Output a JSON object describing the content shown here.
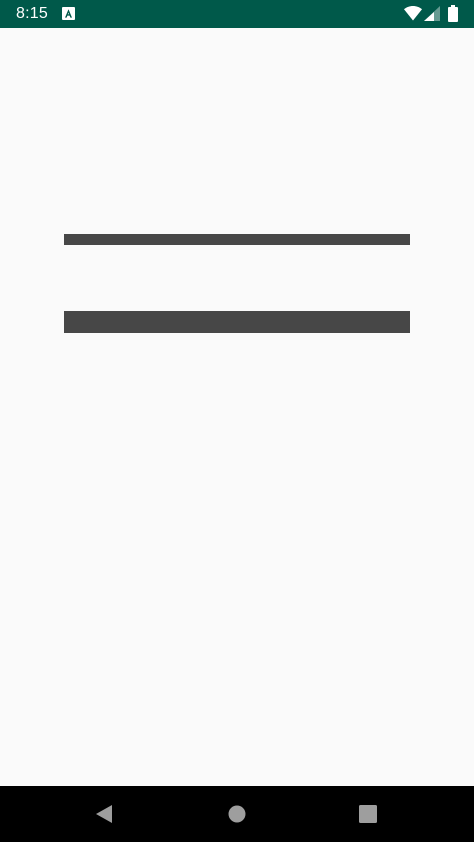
{
  "status_bar": {
    "time": "8:15",
    "background_color": "#00594a",
    "notification_icon": "app-notification-icon",
    "wifi_icon": "wifi-icon",
    "signal_icon": "cell-signal-icon",
    "battery_icon": "battery-icon"
  },
  "content": {
    "background_color": "#fafafa",
    "bar_color": "#474747",
    "placeholders": [
      "thin-placeholder-bar",
      "thick-placeholder-bar"
    ]
  },
  "nav_bar": {
    "back_icon": "back-triangle-icon",
    "home_icon": "home-circle-icon",
    "recents_icon": "recents-square-icon",
    "icon_color": "#9e9e9e"
  }
}
